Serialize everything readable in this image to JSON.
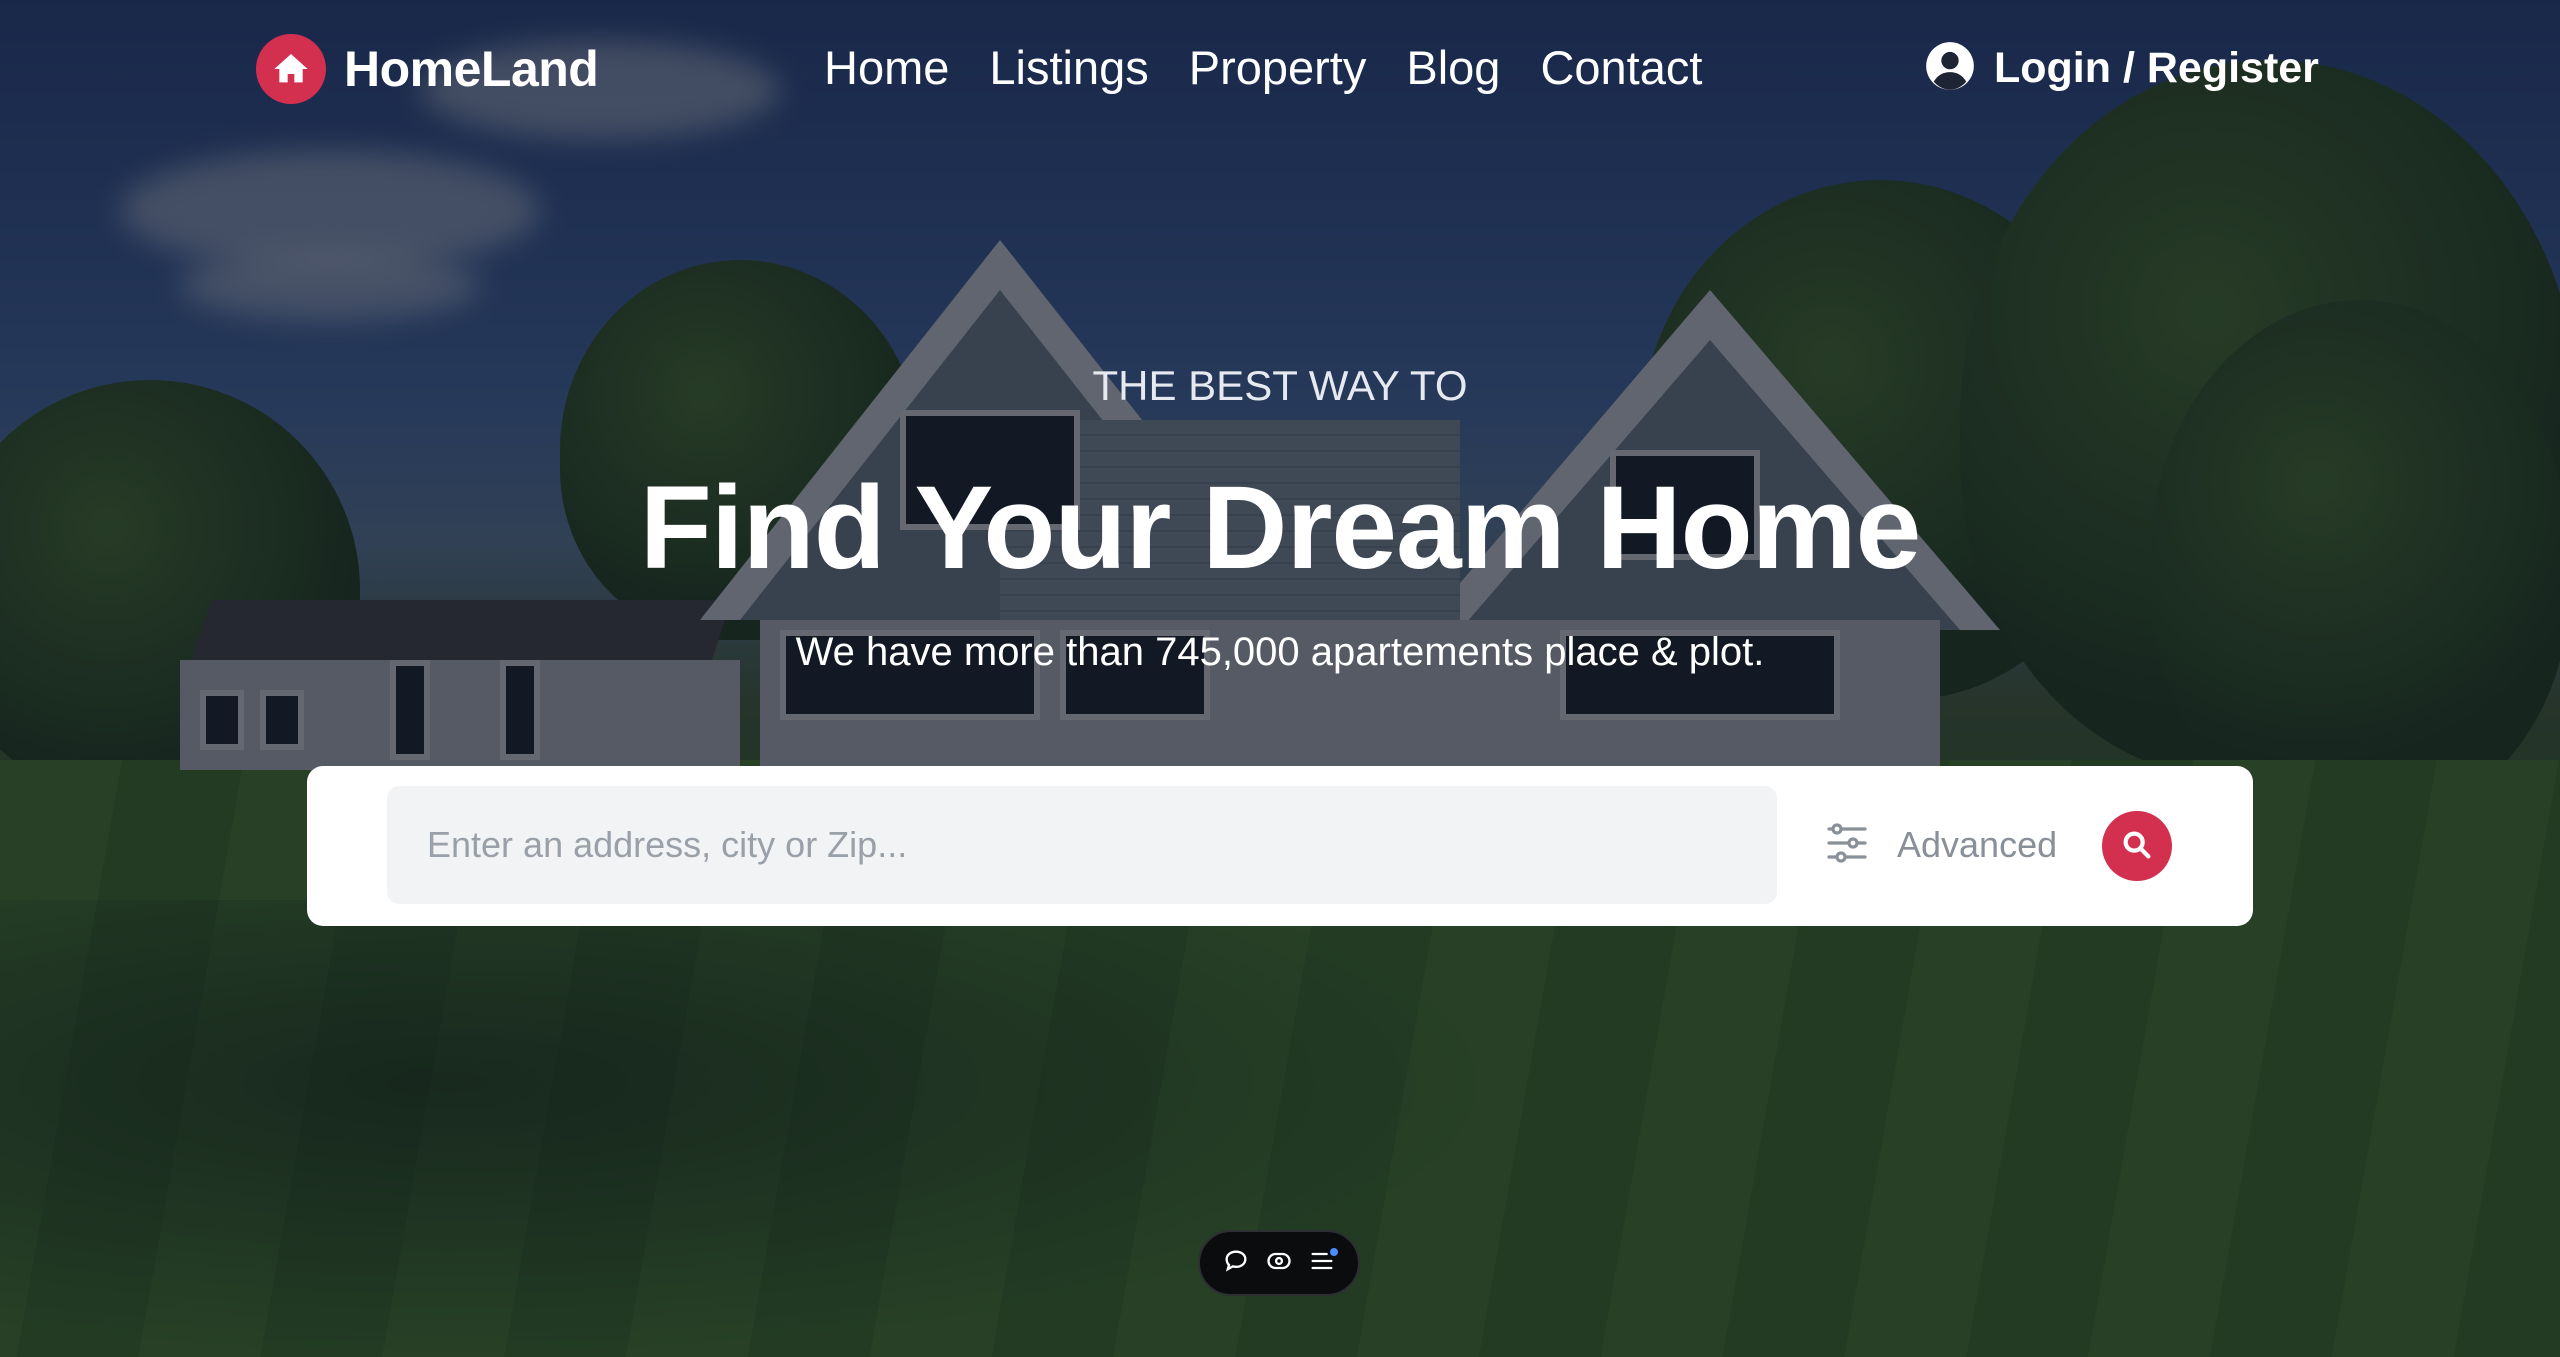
{
  "colors": {
    "brand": "#d32f4f",
    "overlay": "rgba(14,20,34,0.62)",
    "card": "#ffffff",
    "input_bg": "#f2f3f5",
    "muted_text": "#8a9098"
  },
  "header": {
    "logo_icon": "house-icon",
    "logo_text": "HomeLand",
    "nav": [
      {
        "label": "Home"
      },
      {
        "label": "Listings"
      },
      {
        "label": "Property"
      },
      {
        "label": "Blog"
      },
      {
        "label": "Contact"
      }
    ],
    "login_icon": "user-circle-icon",
    "login_label": "Login / Register"
  },
  "hero": {
    "kicker": "THE BEST WAY TO",
    "headline": "Find Your Dream Home",
    "subline": "We have more than 745,000 apartements place & plot."
  },
  "search": {
    "placeholder": "Enter an address, city or Zip...",
    "value": "",
    "advanced_icon": "sliders-icon",
    "advanced_label": "Advanced",
    "submit_icon": "search-icon"
  },
  "toolbar": {
    "items": [
      {
        "icon": "chat-bubble-icon"
      },
      {
        "icon": "eye-icon"
      },
      {
        "icon": "list-icon",
        "badge": true
      }
    ]
  }
}
